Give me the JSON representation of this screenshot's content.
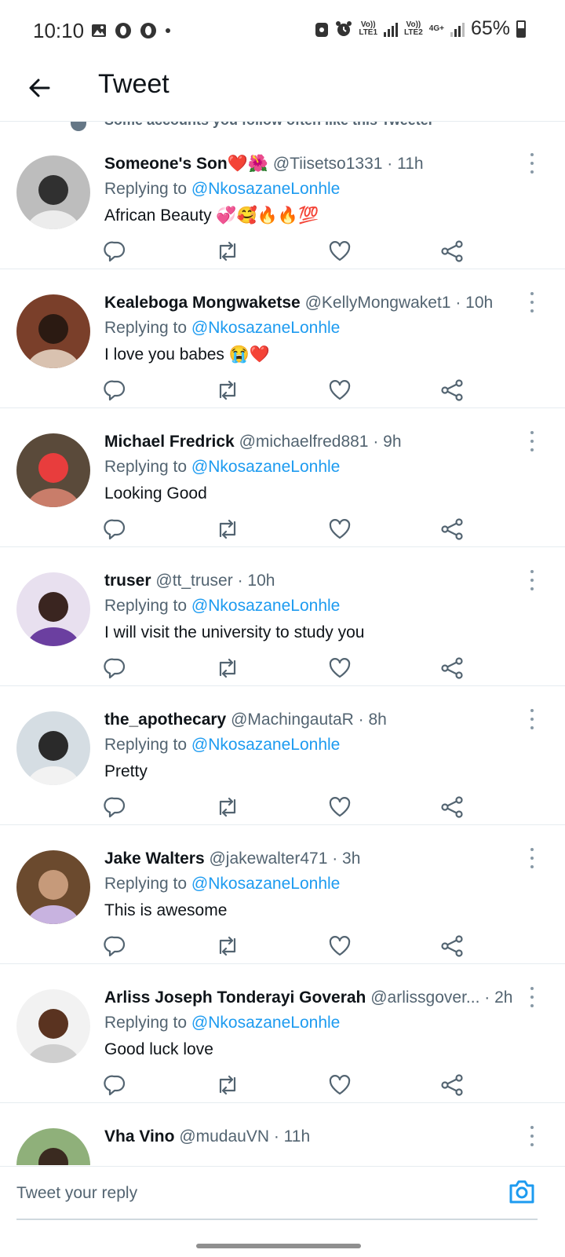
{
  "status_bar": {
    "time": "10:10",
    "net1": "Vo))\nLTE1",
    "net2": "Vo))\nLTE2",
    "net3": "4G+",
    "battery": "65%"
  },
  "header": {
    "title": "Tweet"
  },
  "social_context": "Some accounts you follow often like this Tweeter",
  "reply_prefix": "Replying to ",
  "reply_to": "@NkosazaneLonhle",
  "tweets": [
    {
      "name": "Someone's Son❤️🌺",
      "handle": "@Tiisetso1331",
      "time": " · 11h",
      "text": "African Beauty 💞🥰🔥🔥💯",
      "avatar_colors": [
        "#bdbdbd",
        "#303030",
        "#ececec"
      ]
    },
    {
      "name": "Kealeboga Mongwaketse",
      "handle": "@KellyMongwaket1",
      "time": " · 10h",
      "text": "I love you babes 😭❤️",
      "avatar_colors": [
        "#7a3f2a",
        "#2b1a12",
        "#d9c2b0"
      ]
    },
    {
      "name": "Michael Fredrick",
      "handle": "@michaelfred881",
      "time": " · 9h",
      "text": "Looking Good",
      "avatar_colors": [
        "#5a4a3a",
        "#e83d3d",
        "#c97d6a"
      ]
    },
    {
      "name": "truser",
      "handle": "@tt_truser",
      "time": " · 10h",
      "text": "I will visit the university to study you",
      "avatar_colors": [
        "#e8e0ef",
        "#3a2520",
        "#6b3fa0"
      ]
    },
    {
      "name": "the_apothecary",
      "handle": "@MachingautaR",
      "time": " · 8h",
      "text": "Pretty",
      "avatar_colors": [
        "#d5dde3",
        "#2a2a2a",
        "#f2f2f2"
      ]
    },
    {
      "name": "Jake Walters",
      "handle": "@jakewalter471",
      "time": " · 3h",
      "text": "This is awesome",
      "avatar_colors": [
        "#6b4a2e",
        "#c69a7a",
        "#c8b3e0"
      ]
    },
    {
      "name": "Arliss Joseph Tonderayi Goverah",
      "handle": "@arlissgover...",
      "time": " · 2h",
      "text": "Good luck love",
      "avatar_colors": [
        "#f2f2f2",
        "#5a3320",
        "#cfcfcf"
      ]
    },
    {
      "name": "Vha Vino",
      "handle": "@mudauVN",
      "time": " · 11h",
      "text": "",
      "avatar_colors": [
        "#8fb07a",
        "#3a2a20",
        "#5d7f45"
      ]
    }
  ],
  "composer": {
    "placeholder": "Tweet your reply"
  },
  "icons": {
    "reply": "reply-icon",
    "retweet": "retweet-icon",
    "like": "heart-icon",
    "share": "share-icon",
    "camera": "camera-icon",
    "back": "back-arrow-icon"
  },
  "colors": {
    "accent": "#1d9bf0",
    "secondary_text": "#536471",
    "primary_text": "#0f1419"
  }
}
